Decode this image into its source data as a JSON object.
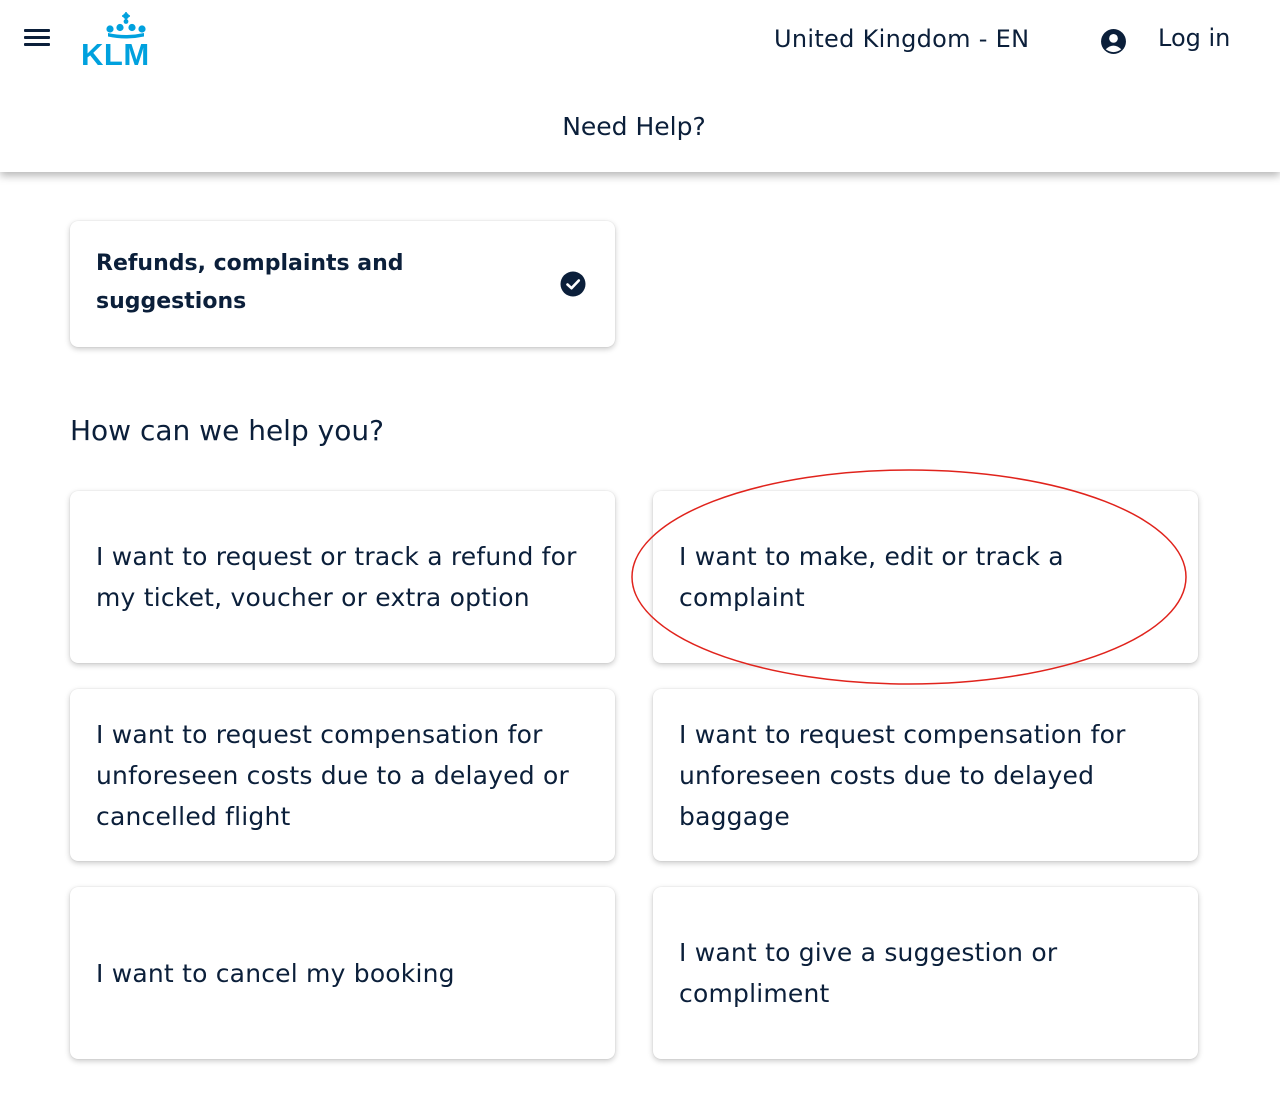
{
  "header": {
    "menu_icon": "menu-icon",
    "logo_text": "KLM",
    "locale": "United Kingdom - EN",
    "user_icon": "user-icon",
    "login_label": "Log in",
    "page_title": "Need Help?"
  },
  "selected_category": {
    "label": "Refunds, complaints and suggestions",
    "icon": "check-circle-icon"
  },
  "section_title": "How can we help you?",
  "options": [
    {
      "label": "I want to request or track a refund for my ticket, voucher or extra option"
    },
    {
      "label": "I want to make, edit or track a complaint",
      "highlighted": true
    },
    {
      "label": "I want to request compensation for unforeseen costs due to a delayed or cancelled flight"
    },
    {
      "label": "I want to request compensation for unforeseen costs due to delayed baggage"
    },
    {
      "label": "I want to cancel my booking"
    },
    {
      "label": "I want to give a suggestion or compliment"
    }
  ],
  "colors": {
    "text": "#0b1f3a",
    "brand": "#00a1de",
    "highlight_annotation": "#e0231c"
  }
}
